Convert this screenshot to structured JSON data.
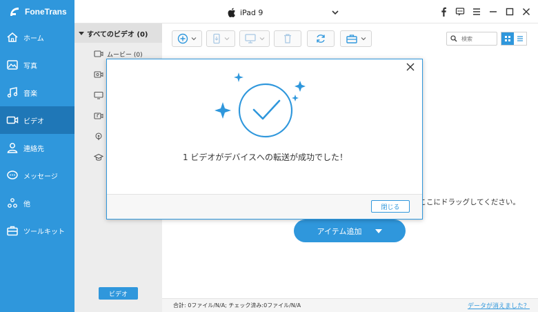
{
  "app": {
    "name": "FoneTrans"
  },
  "device": {
    "name": "iPad 9"
  },
  "sidebar": {
    "items": [
      {
        "label": "ホーム",
        "icon": "home-icon"
      },
      {
        "label": "写真",
        "icon": "photo-icon"
      },
      {
        "label": "音楽",
        "icon": "music-icon"
      },
      {
        "label": "ビデオ",
        "icon": "video-icon",
        "active": true
      },
      {
        "label": "連絡先",
        "icon": "contacts-icon"
      },
      {
        "label": "メッセージ",
        "icon": "message-icon"
      },
      {
        "label": "他",
        "icon": "other-icon"
      },
      {
        "label": "ツールキット",
        "icon": "toolkit-icon"
      }
    ]
  },
  "categories": {
    "header": "すべてのビデオ (0)",
    "items": [
      {
        "label": "ムービー (0)",
        "icon": "movie-icon"
      }
    ],
    "footer_tag": "ビデオ"
  },
  "toolbar": {
    "search_placeholder": "検索"
  },
  "main": {
    "drop_hint": "をここにドラッグしてください。",
    "add_button": "アイテム追加"
  },
  "status": {
    "summary": "合計: 0ファイル/N/A; チェック済み:0ファイル/N/A",
    "link": "データが消えました？"
  },
  "dialog": {
    "message": "1 ビデオがデバイスへの転送が成功でした！",
    "close_button": "閉じる"
  },
  "colors": {
    "accent": "#2f97dc",
    "accent_dark": "#1f77b7"
  }
}
